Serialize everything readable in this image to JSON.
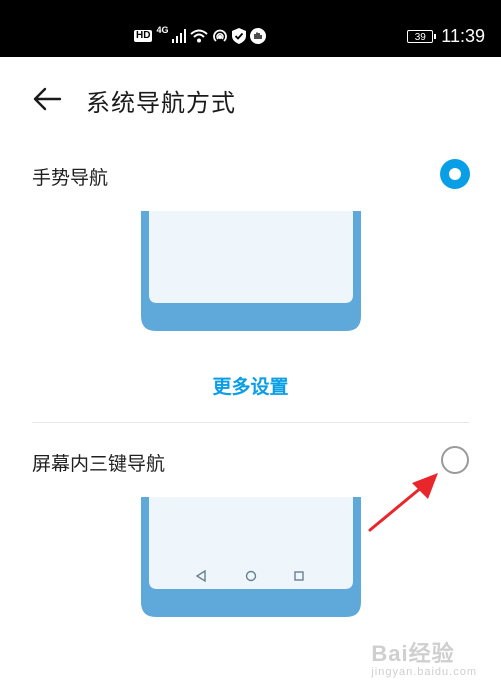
{
  "status_bar": {
    "network_badge": "HD",
    "network_type": "4G",
    "battery_level": "39",
    "time": "11:39"
  },
  "header": {
    "title": "系统导航方式"
  },
  "options": [
    {
      "label": "手势导航",
      "selected": true
    },
    {
      "label": "屏幕内三键导航",
      "selected": false
    }
  ],
  "more_settings_label": "更多设置",
  "watermark": "Bai经验",
  "watermark_sub": "jingyan.baidu.com",
  "colors": {
    "accent": "#0a9ee6",
    "phone_frame": "#5ea8da",
    "phone_screen": "#eef6fc",
    "annotation_arrow": "#e8262b"
  }
}
